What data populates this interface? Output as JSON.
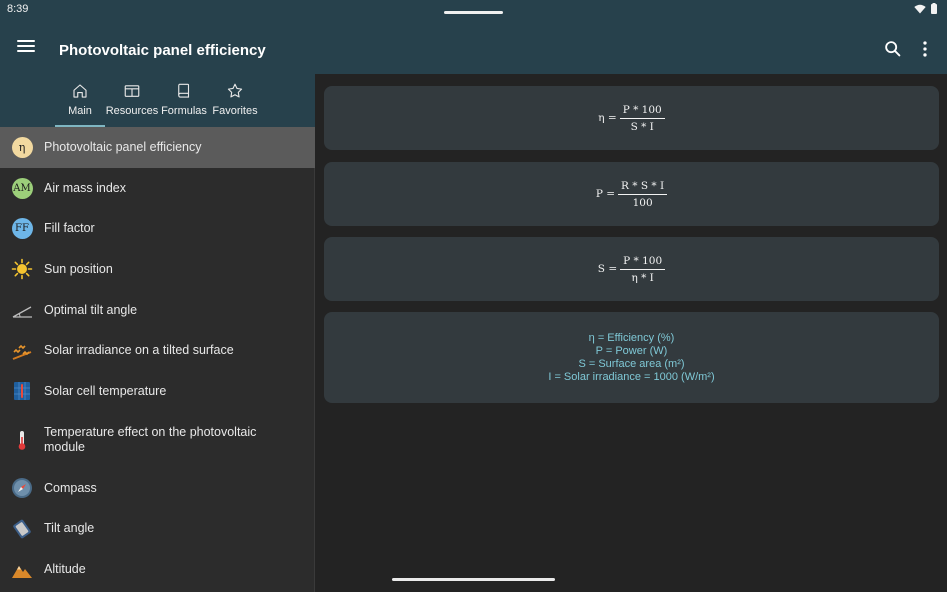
{
  "status": {
    "time": "8:39"
  },
  "appbar": {
    "title": "Photovoltaic panel efficiency"
  },
  "tabs": [
    {
      "label": "Main",
      "icon": "home-icon"
    },
    {
      "label": "Resources",
      "icon": "table-icon"
    },
    {
      "label": "Formulas",
      "icon": "book-icon"
    },
    {
      "label": "Favorites",
      "icon": "star-icon"
    }
  ],
  "sidebar": {
    "items": [
      {
        "label": "Photovoltaic panel efficiency",
        "badge": "η",
        "badge_color": "#f2d9a0"
      },
      {
        "label": "Air mass index",
        "badge": "AM",
        "badge_color": "#9ccf7a"
      },
      {
        "label": "Fill factor",
        "badge": "FF",
        "badge_color": "#6eb6e8"
      },
      {
        "label": "Sun position",
        "icon": "sun-icon"
      },
      {
        "label": "Optimal tilt angle",
        "icon": "angle-icon"
      },
      {
        "label": "Solar irradiance on a tilted surface",
        "icon": "irradiance-icon"
      },
      {
        "label": "Solar cell temperature",
        "icon": "solar-cell-icon"
      },
      {
        "label": "Temperature effect on the photovoltaic module",
        "icon": "thermometer-icon"
      },
      {
        "label": "Compass",
        "icon": "compass-icon"
      },
      {
        "label": "Tilt angle",
        "icon": "tilt-icon"
      },
      {
        "label": "Altitude",
        "icon": "mountain-icon"
      }
    ]
  },
  "formulas": [
    {
      "lhs": "η =",
      "num": "P * 100",
      "den": "S * I"
    },
    {
      "lhs": "P =",
      "num": "R * S * I",
      "den": "100"
    },
    {
      "lhs": "S =",
      "num": "P * 100",
      "den": "η * I"
    }
  ],
  "legend": [
    "η = Efficiency (%)",
    "P = Power (W)",
    "S = Surface area (m²)",
    "I = Solar irradiance = 1000 (W/m²)"
  ],
  "colors": {
    "appbar": "#27414c",
    "accent": "#7fc8d6",
    "selected": "#5b5b5b"
  }
}
